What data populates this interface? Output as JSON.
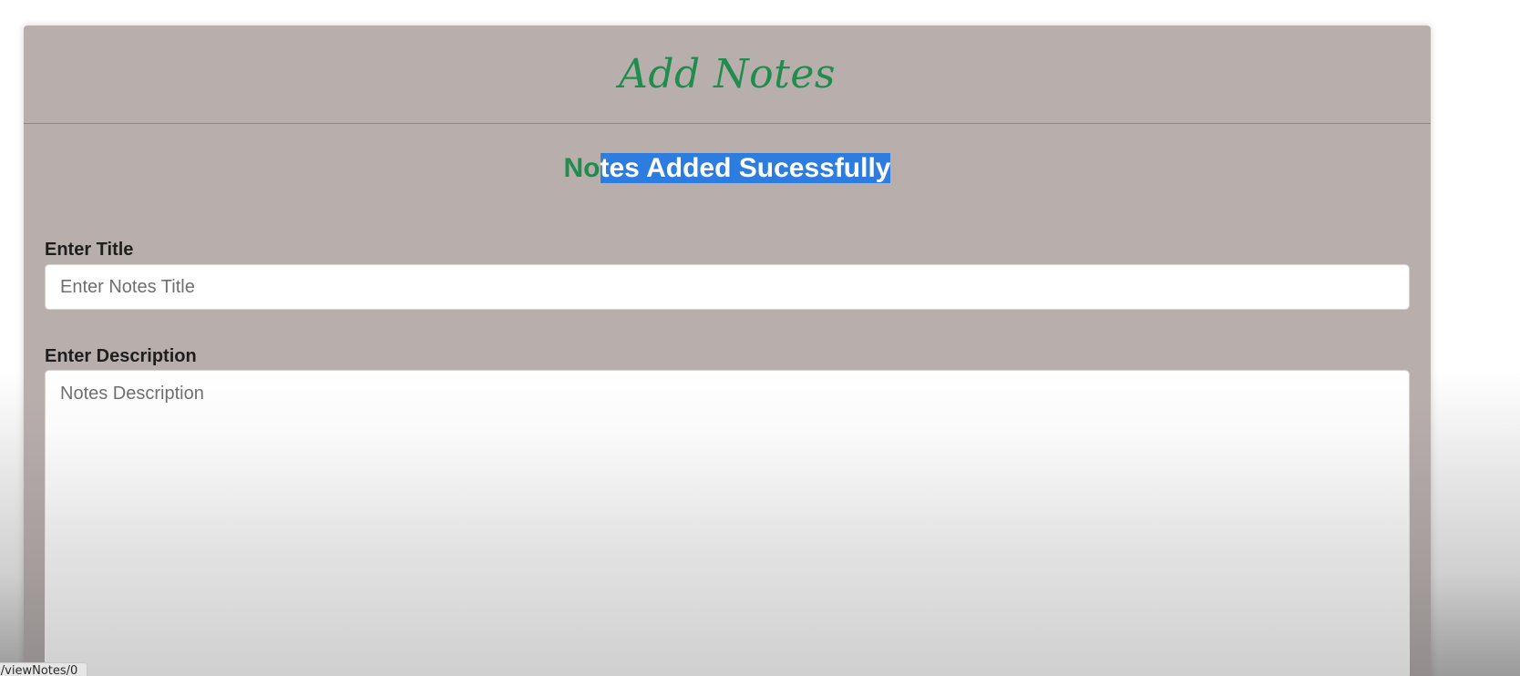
{
  "page": {
    "heading": "Add Notes",
    "success_message_prefix": "No",
    "success_message_selected": "tes Added Sucessfully"
  },
  "form": {
    "title_label": "Enter Title",
    "title_placeholder": "Enter Notes Title",
    "description_label": "Enter Description",
    "description_placeholder": "Notes Description"
  },
  "status_bar": {
    "link_url": "s/viewNotes/0"
  },
  "colors": {
    "accent_green": "#218c4e",
    "card_background": "#b8afad",
    "selection_blue": "#2d7de0"
  }
}
